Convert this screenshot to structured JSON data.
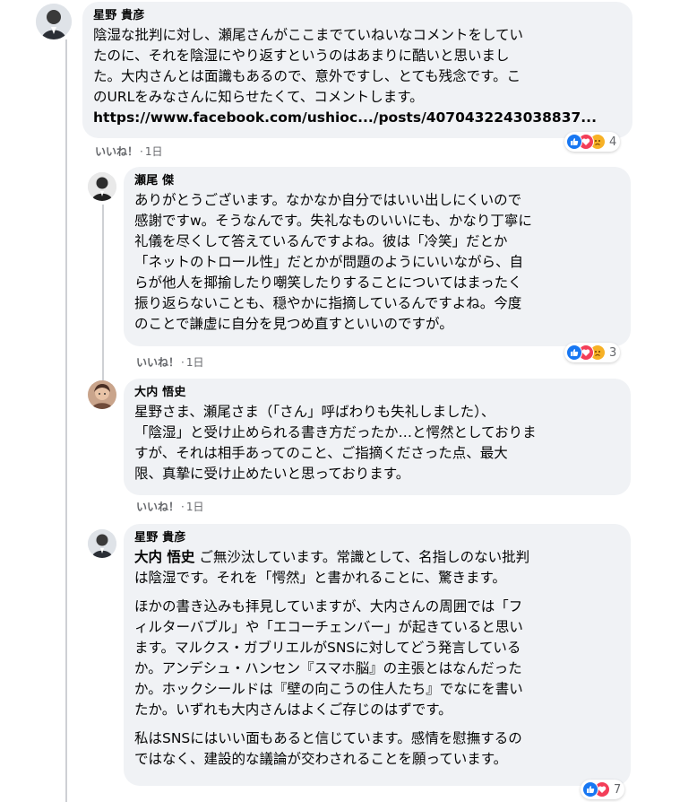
{
  "comments": [
    {
      "author": "星野 貴彦",
      "lines": [
        "陰湿な批判に対し、瀬尾さんがここまでていねいなコメントをしてい",
        "たのに、それを陰湿にやり返すというのはあまりに酷いと思いまし",
        "た。大内さんとは面識もあるので、意外ですし、とても残念です。こ",
        "のURLをみなさんに知らせたくて、コメントします。"
      ],
      "link": "https://www.facebook.com/ushioc.../posts/4070432243038837...",
      "like_label": "いいね！",
      "time": "1日",
      "reaction_count": "4"
    },
    {
      "author": "瀬尾 傑",
      "lines": [
        "ありがとうございます。なかなか自分ではいい出しにくいので",
        "感謝ですw。そうなんです。失礼なものいいにも、かなり丁寧に",
        "礼儀を尽くして答えているんですよね。彼は「冷笑」だとか",
        "「ネットのトロール性」だとかが問題のようにいいながら、自",
        "らが他人を揶揄したり嘲笑したりすることについてはまったく",
        "振り返らないことも、穏やかに指摘しているんですよね。今度",
        "のことで謙虚に自分を見つめ直すといいのですが。"
      ],
      "like_label": "いいね！",
      "time": "1日",
      "reaction_count": "3"
    },
    {
      "author": "大内 悟史",
      "lines": [
        "星野さま、瀬尾さま（「さん」呼ばわりも失礼しました）、",
        "「陰湿」と受け止められる書き方だったか…と愕然としておりま",
        "すが、それは相手あってのこと、ご指摘くださった点、最大",
        "限、真摯に受け止めたいと思っております。"
      ],
      "like_label": "いいね！",
      "time": "1日"
    },
    {
      "author": "星野 貴彦",
      "mention": "大内 悟史",
      "first_line_rest": " ご無沙汰しています。常識として、名指しのない批判",
      "para1_lines": [
        "は陰湿です。それを「愕然」と書かれることに、驚きます。"
      ],
      "para2_lines": [
        "ほかの書き込みも拝見していますが、大内さんの周囲では「フ",
        "ィルターバブル」や「エコーチェンバー」が起きていると思い",
        "ます。マルクス・ガブリエルがSNSに対してどう発言している",
        "か。アンデシュ・ハンセン『スマホ脳』の主張とはなんだった",
        "か。ホックシールドは『壁の向こうの住人たち』でなにを書い",
        "たか。いずれも大内さんはよくご存じのはずです。"
      ],
      "para3_lines": [
        "私はSNSにはいい面もあると信じています。感情を慰撫するの",
        "ではなく、建設的な議論が交わされることを願っています。"
      ],
      "reaction_count": "7"
    }
  ],
  "colors": {
    "bubble": "#f0f2f5",
    "meta": "#65676b",
    "like_blue": "#1877f2",
    "love_red": "#f33e58",
    "sad_yellow": "#f7b125"
  },
  "icons": [
    "avatar-hoshino",
    "avatar-seo",
    "avatar-ouchi",
    "like-reaction-icon",
    "love-reaction-icon",
    "sad-reaction-icon"
  ]
}
